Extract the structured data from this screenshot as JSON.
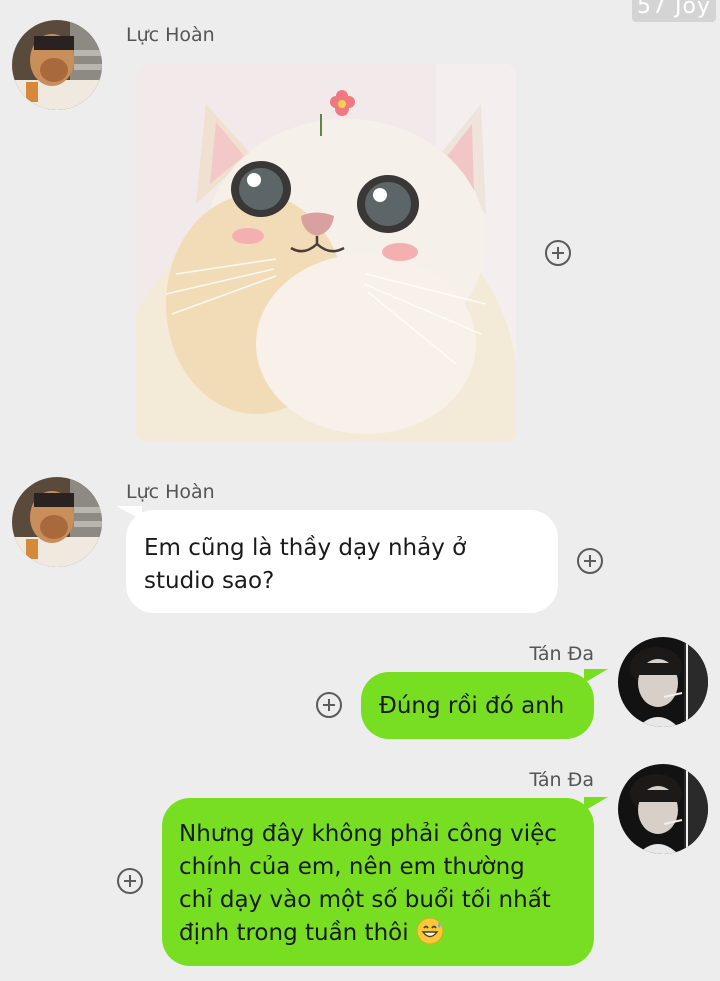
{
  "watermark": {
    "text": "57 Joy"
  },
  "messages": [
    {
      "sender": "Lực Hoàn",
      "type": "sticker",
      "sticker": "cat-sticker"
    },
    {
      "sender": "Lực Hoàn",
      "type": "text",
      "lines": [
        "Em cũng là thầy dạy nhảy ở",
        "studio sao?"
      ]
    },
    {
      "sender": "Tán Đa",
      "type": "text",
      "lines": [
        "Đúng rồi đó anh"
      ]
    },
    {
      "sender": "Tán Đa",
      "type": "text",
      "lines": [
        "Nhưng đây không phải công việc",
        "chính của em, nên em thường",
        "chỉ dạy vào một số buổi tối nhất",
        "định trong tuần thôi"
      ],
      "emoji": "grinning-sweat-emoji"
    }
  ],
  "icons": {
    "add_reaction": "plus-circle-icon"
  },
  "colors": {
    "background": "#ededed",
    "incoming_bubble": "#ffffff",
    "outgoing_bubble": "#78de22",
    "name_text": "#555555"
  }
}
